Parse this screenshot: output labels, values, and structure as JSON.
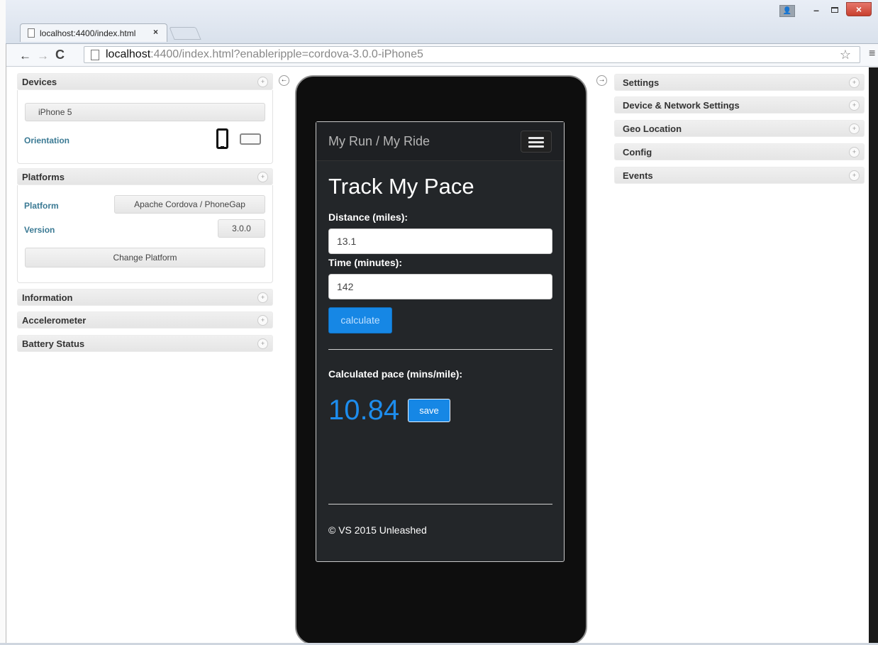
{
  "browser": {
    "tab_title": "localhost:4400/index.html",
    "tab_close": "×",
    "url_host": "localhost",
    "url_rest": ":4400/index.html?enableripple=cordova-3.0.0-iPhone5",
    "window_controls": {
      "minimize": "–",
      "close": "×",
      "user": "👤"
    },
    "nav": {
      "back": "←",
      "forward": "→",
      "reload": "C",
      "star": "☆",
      "menu": "≡"
    }
  },
  "left_panels": {
    "devices": {
      "title": "Devices",
      "device_value": "iPhone 5",
      "orientation_label": "Orientation"
    },
    "platforms": {
      "title": "Platforms",
      "platform_label": "Platform",
      "platform_value": "Apache Cordova / PhoneGap",
      "version_label": "Version",
      "version_value": "3.0.0",
      "change_button": "Change Platform"
    },
    "collapsed": [
      {
        "title": "Information"
      },
      {
        "title": "Accelerometer"
      },
      {
        "title": "Battery Status"
      }
    ]
  },
  "right_panels": [
    {
      "title": "Settings"
    },
    {
      "title": "Device & Network Settings"
    },
    {
      "title": "Geo Location"
    },
    {
      "title": "Config"
    },
    {
      "title": "Events"
    }
  ],
  "panel_toggle_glyph": "+",
  "collapse_left_glyph": "←",
  "collapse_right_glyph": "→",
  "app": {
    "brand": "My Run / My Ride",
    "heading": "Track My Pace",
    "distance_label": "Distance (miles):",
    "distance_value": "13.1",
    "time_label": "Time (minutes):",
    "time_value": "142",
    "calculate_button": "calculate",
    "pace_label": "Calculated pace (mins/mile):",
    "pace_value": "10.84",
    "save_button": "save",
    "footer": "© VS 2015 Unleashed"
  },
  "colors": {
    "accent_blue": "#1687e5",
    "pace_blue": "#1d8ded",
    "label_teal": "#3b7a94",
    "screen_bg": "#232629"
  }
}
